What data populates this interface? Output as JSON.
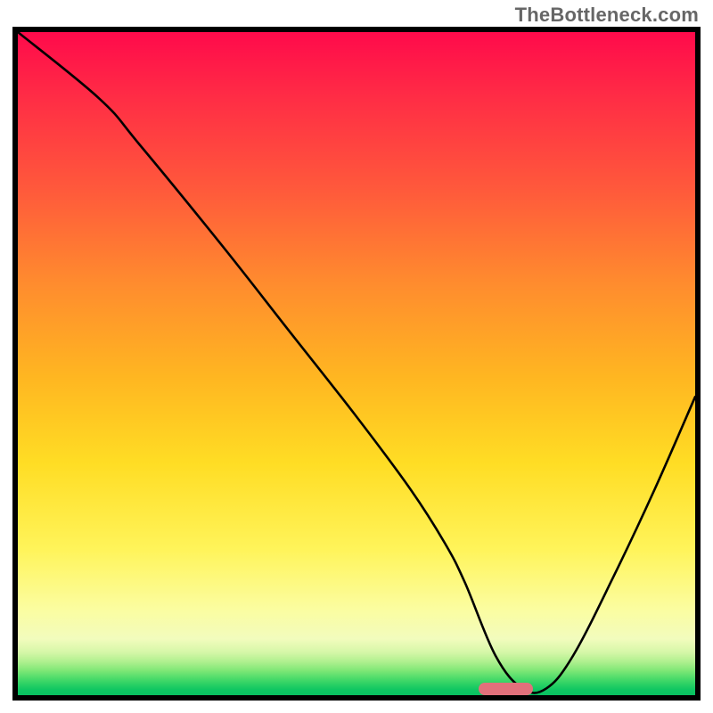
{
  "watermark": "TheBottleneck.com",
  "colors": {
    "watermark_text": "#666666",
    "border": "#000000",
    "curve": "#000000",
    "marker": "#e2707b",
    "gradient_top": "#ff0a4b",
    "gradient_bottom": "#08c161"
  },
  "chart_data": {
    "type": "line",
    "title": "",
    "xlabel": "",
    "ylabel": "",
    "xlim": [
      0,
      100
    ],
    "ylim": [
      0,
      100
    ],
    "grid": false,
    "legend": false,
    "x": [
      0,
      12,
      18,
      30,
      40,
      50,
      58,
      63,
      66,
      70.5,
      74.5,
      78,
      82,
      88,
      94,
      100
    ],
    "values": [
      100,
      90,
      83,
      68,
      55,
      42,
      31,
      23,
      17,
      6,
      1,
      1,
      6,
      18,
      31,
      45
    ],
    "marker": {
      "x_center": 72,
      "y": 1,
      "width_pct": 8
    },
    "background": "vertical-rainbow-red-to-green"
  }
}
